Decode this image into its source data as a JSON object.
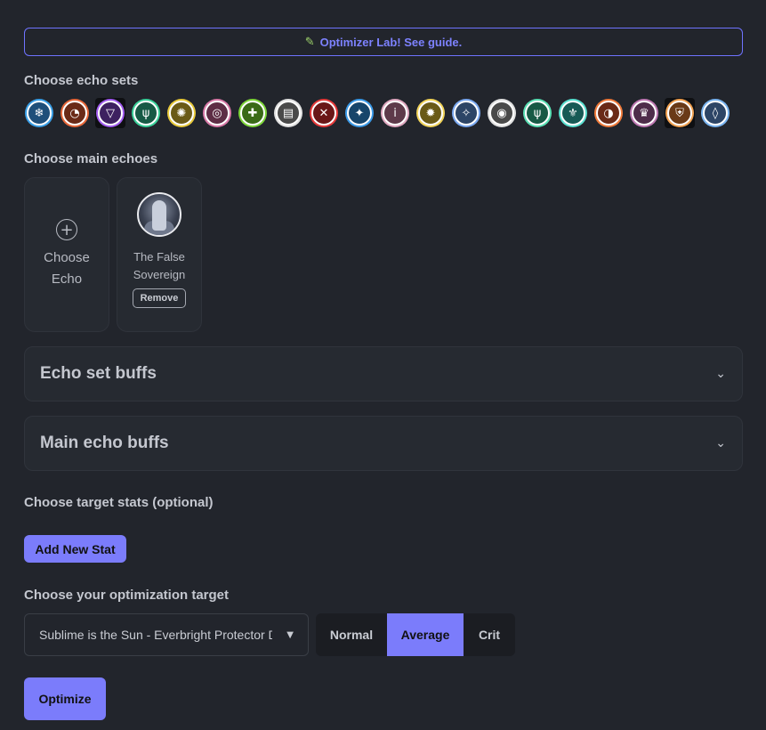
{
  "banner": {
    "icon": "pencil-icon",
    "text": "Optimizer Lab! See guide."
  },
  "sections": {
    "echo_sets": "Choose echo sets",
    "main_echoes": "Choose main echoes",
    "target_stats": "Choose target stats (optional)",
    "optimization_target": "Choose your optimization target"
  },
  "echo_sets": [
    {
      "name": "snowflake-set-icon",
      "glyph": "❄",
      "color": "#3aa0e8",
      "bg": "#1f4f7a",
      "selected": false
    },
    {
      "name": "flame-swirl-set-icon",
      "glyph": "◔",
      "color": "#e8683a",
      "bg": "#6a2a17",
      "selected": false
    },
    {
      "name": "triangle-void-set-icon",
      "glyph": "▽",
      "color": "#a25cf0",
      "bg": "#3d2160",
      "selected": true
    },
    {
      "name": "wings-set-icon",
      "glyph": "ψ",
      "color": "#3ad19a",
      "bg": "#175a45",
      "selected": false
    },
    {
      "name": "sun-set-icon",
      "glyph": "✺",
      "color": "#e8c93a",
      "bg": "#6a5a17",
      "selected": false
    },
    {
      "name": "spiral-set-icon",
      "glyph": "◎",
      "color": "#d97aa8",
      "bg": "#5e2d45",
      "selected": false
    },
    {
      "name": "plus-set-icon",
      "glyph": "✚",
      "color": "#7ed63a",
      "bg": "#3a6a17",
      "selected": false
    },
    {
      "name": "shield-list-set-icon",
      "glyph": "▤",
      "color": "#e0e0e0",
      "bg": "#4a4a4a",
      "selected": false
    },
    {
      "name": "crossed-blades-set-icon",
      "glyph": "✕",
      "color": "#e83a3a",
      "bg": "#6a1717",
      "selected": false
    },
    {
      "name": "star-compass-set-icon",
      "glyph": "✦",
      "color": "#3a9ae8",
      "bg": "#17456a",
      "selected": false
    },
    {
      "name": "figure-set-icon",
      "glyph": "i",
      "color": "#e0a8c0",
      "bg": "#5e3a4a",
      "selected": false
    },
    {
      "name": "radiant-sun-set-icon",
      "glyph": "✹",
      "color": "#f2d45a",
      "bg": "#6a5a17",
      "selected": false
    },
    {
      "name": "sparkle-set-icon",
      "glyph": "✧",
      "color": "#7aa8f0",
      "bg": "#2d4566",
      "selected": false
    },
    {
      "name": "target-set-icon",
      "glyph": "◉",
      "color": "#e0e0e0",
      "bg": "#4a4a4a",
      "selected": false
    },
    {
      "name": "winged-crest-set-icon",
      "glyph": "ψ",
      "color": "#5ae0b4",
      "bg": "#175a45",
      "selected": false
    },
    {
      "name": "fleur-set-icon",
      "glyph": "⚜",
      "color": "#5ae0d0",
      "bg": "#175a55",
      "selected": false
    },
    {
      "name": "ember-swirl-set-icon",
      "glyph": "◑",
      "color": "#f07a3a",
      "bg": "#6a2a17",
      "selected": false
    },
    {
      "name": "crown-set-icon",
      "glyph": "♛",
      "color": "#c07ab4",
      "bg": "#4e2d4a",
      "selected": false
    },
    {
      "name": "shield-crest-set-icon",
      "glyph": "⛨",
      "color": "#f0a050",
      "bg": "#6a3a17",
      "selected": true
    },
    {
      "name": "drop-set-icon",
      "glyph": "◊",
      "color": "#7ab4f0",
      "bg": "#2d4566",
      "selected": false
    }
  ],
  "main_echoes": {
    "add_label": "Choose Echo",
    "selected": {
      "name": "The False Sovereign",
      "remove_label": "Remove"
    }
  },
  "accordions": {
    "echo_set_buffs": "Echo set buffs",
    "main_echo_buffs": "Main echo buffs"
  },
  "add_stat_label": "Add New Stat",
  "optimization": {
    "selected_target": "Sublime is the Sun - Everbright Protector DMG",
    "modes": [
      "Normal",
      "Average",
      "Crit"
    ],
    "active_mode": "Average"
  },
  "optimize_label": "Optimize",
  "colors": {
    "accent": "#7b7cfb",
    "background": "#22252c",
    "card": "#262a31"
  }
}
